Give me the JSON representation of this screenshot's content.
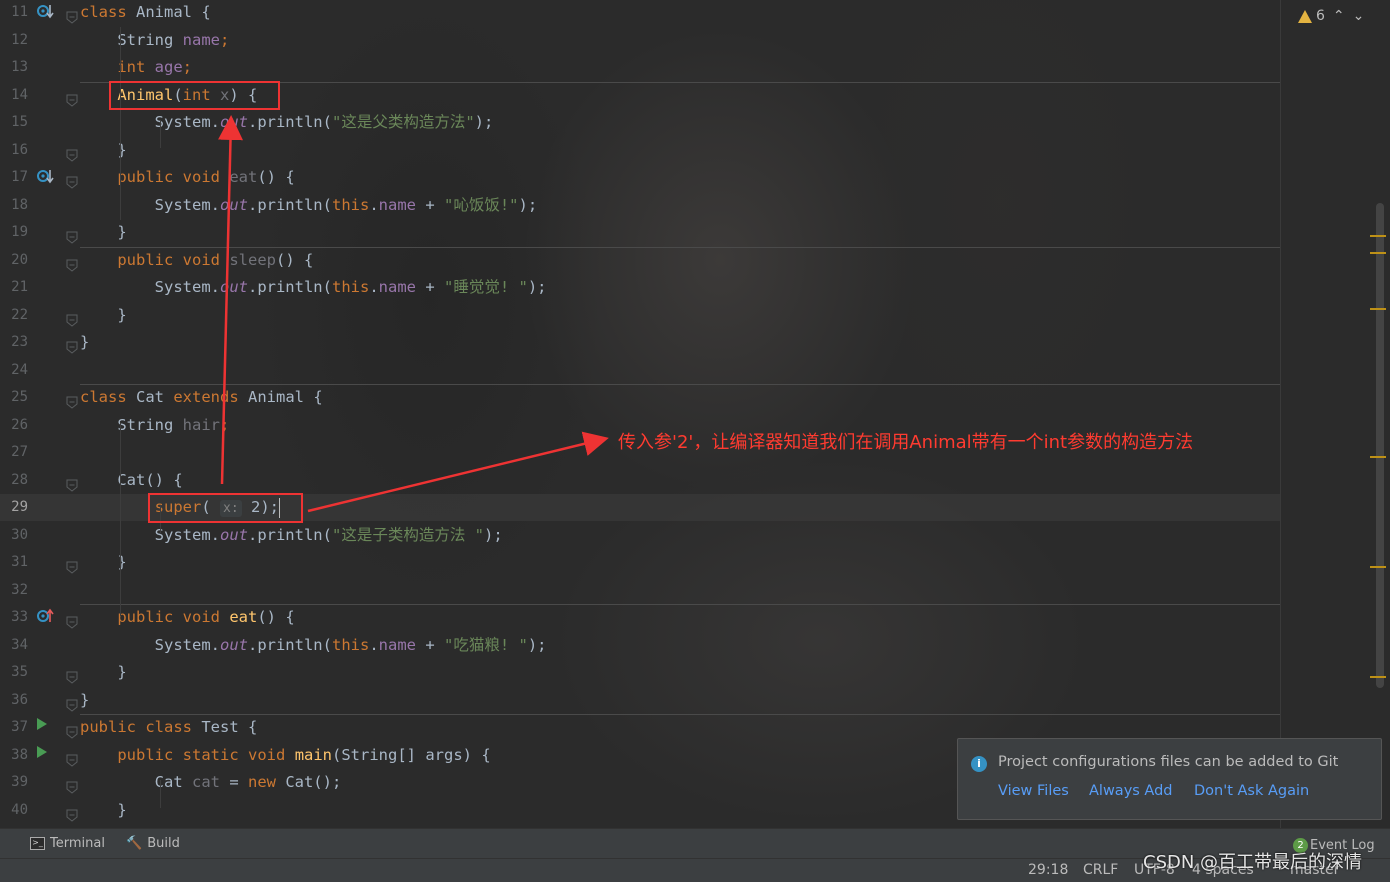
{
  "editor": {
    "lines": [
      {
        "n": "11",
        "tokens": [
          {
            "t": "class",
            "c": "kw"
          },
          {
            "t": " Animal {"
          }
        ]
      },
      {
        "n": "12",
        "tokens": [
          {
            "t": "    String "
          },
          {
            "t": "name",
            "c": "field"
          },
          {
            "t": ";",
            "c": "kw"
          }
        ]
      },
      {
        "n": "13",
        "tokens": [
          {
            "t": "    "
          },
          {
            "t": "int",
            "c": "kw"
          },
          {
            "t": " "
          },
          {
            "t": "age",
            "c": "field"
          },
          {
            "t": ";",
            "c": "kw"
          }
        ]
      },
      {
        "n": "14",
        "tokens": [
          {
            "t": "    "
          },
          {
            "t": "Animal",
            "c": "fn"
          },
          {
            "t": "("
          },
          {
            "t": "int",
            "c": "kw"
          },
          {
            "t": " "
          },
          {
            "t": "x",
            "c": "unused"
          },
          {
            "t": ") {"
          }
        ]
      },
      {
        "n": "15",
        "tokens": [
          {
            "t": "        System."
          },
          {
            "t": "out",
            "c": "ital"
          },
          {
            "t": ".println("
          },
          {
            "t": "\"这是父类构造方法\"",
            "c": "str"
          },
          {
            "t": ");"
          }
        ]
      },
      {
        "n": "16",
        "tokens": [
          {
            "t": "    }"
          }
        ]
      },
      {
        "n": "17",
        "tokens": [
          {
            "t": "    "
          },
          {
            "t": "public",
            "c": "kw"
          },
          {
            "t": " "
          },
          {
            "t": "void",
            "c": "kw"
          },
          {
            "t": " "
          },
          {
            "t": "eat",
            "c": "unused"
          },
          {
            "t": "() {"
          }
        ]
      },
      {
        "n": "18",
        "tokens": [
          {
            "t": "        System."
          },
          {
            "t": "out",
            "c": "ital"
          },
          {
            "t": ".println("
          },
          {
            "t": "this",
            "c": "kw"
          },
          {
            "t": "."
          },
          {
            "t": "name",
            "c": "field"
          },
          {
            "t": " + "
          },
          {
            "t": "\"吣饭饭!\"",
            "c": "str"
          },
          {
            "t": ");"
          }
        ]
      },
      {
        "n": "19",
        "tokens": [
          {
            "t": "    }"
          }
        ]
      },
      {
        "n": "20",
        "tokens": [
          {
            "t": "    "
          },
          {
            "t": "public",
            "c": "kw"
          },
          {
            "t": " "
          },
          {
            "t": "void",
            "c": "kw"
          },
          {
            "t": " "
          },
          {
            "t": "sleep",
            "c": "unused"
          },
          {
            "t": "() {"
          }
        ]
      },
      {
        "n": "21",
        "tokens": [
          {
            "t": "        System."
          },
          {
            "t": "out",
            "c": "ital"
          },
          {
            "t": ".println("
          },
          {
            "t": "this",
            "c": "kw"
          },
          {
            "t": "."
          },
          {
            "t": "name",
            "c": "field"
          },
          {
            "t": " + "
          },
          {
            "t": "\"睡觉觉! \"",
            "c": "str"
          },
          {
            "t": ");"
          }
        ]
      },
      {
        "n": "22",
        "tokens": [
          {
            "t": "    }"
          }
        ]
      },
      {
        "n": "23",
        "tokens": [
          {
            "t": "}"
          }
        ]
      },
      {
        "n": "24",
        "tokens": []
      },
      {
        "n": "25",
        "tokens": [
          {
            "t": "class",
            "c": "kw"
          },
          {
            "t": " Cat "
          },
          {
            "t": "extends",
            "c": "kw"
          },
          {
            "t": " Animal {"
          }
        ]
      },
      {
        "n": "26",
        "tokens": [
          {
            "t": "    String "
          },
          {
            "t": "hair",
            "c": "unused"
          },
          {
            "t": ";",
            "c": "kw"
          }
        ]
      },
      {
        "n": "27",
        "tokens": []
      },
      {
        "n": "28",
        "tokens": [
          {
            "t": "    Cat() {"
          }
        ]
      },
      {
        "n": "29",
        "tokens": [
          {
            "t": "        "
          },
          {
            "t": "super",
            "c": "kw"
          },
          {
            "t": "( "
          },
          {
            "t": "x:",
            "c": "hint"
          },
          {
            "t": " 2);"
          }
        ]
      },
      {
        "n": "30",
        "tokens": [
          {
            "t": "        System."
          },
          {
            "t": "out",
            "c": "ital"
          },
          {
            "t": ".println("
          },
          {
            "t": "\"这是子类构造方法 \"",
            "c": "str"
          },
          {
            "t": ");"
          }
        ]
      },
      {
        "n": "31",
        "tokens": [
          {
            "t": "    }"
          }
        ]
      },
      {
        "n": "32",
        "tokens": []
      },
      {
        "n": "33",
        "tokens": [
          {
            "t": "    "
          },
          {
            "t": "public",
            "c": "kw"
          },
          {
            "t": " "
          },
          {
            "t": "void",
            "c": "kw"
          },
          {
            "t": " "
          },
          {
            "t": "eat",
            "c": "fn"
          },
          {
            "t": "() {"
          }
        ]
      },
      {
        "n": "34",
        "tokens": [
          {
            "t": "        System."
          },
          {
            "t": "out",
            "c": "ital"
          },
          {
            "t": ".println("
          },
          {
            "t": "this",
            "c": "kw"
          },
          {
            "t": "."
          },
          {
            "t": "name",
            "c": "field"
          },
          {
            "t": " + "
          },
          {
            "t": "\"吃猫粮! \"",
            "c": "str"
          },
          {
            "t": ");"
          }
        ]
      },
      {
        "n": "35",
        "tokens": [
          {
            "t": "    }"
          }
        ]
      },
      {
        "n": "36",
        "tokens": [
          {
            "t": "}"
          }
        ]
      },
      {
        "n": "37",
        "tokens": [
          {
            "t": "public",
            "c": "kw"
          },
          {
            "t": " "
          },
          {
            "t": "class",
            "c": "kw"
          },
          {
            "t": " Test {"
          }
        ]
      },
      {
        "n": "38",
        "tokens": [
          {
            "t": "    "
          },
          {
            "t": "public",
            "c": "kw"
          },
          {
            "t": " "
          },
          {
            "t": "static",
            "c": "kw"
          },
          {
            "t": " "
          },
          {
            "t": "void",
            "c": "kw"
          },
          {
            "t": " "
          },
          {
            "t": "main",
            "c": "fn"
          },
          {
            "t": "(String[] args) {"
          }
        ]
      },
      {
        "n": "39",
        "tokens": [
          {
            "t": "        Cat "
          },
          {
            "t": "cat",
            "c": "unused"
          },
          {
            "t": " = "
          },
          {
            "t": "new",
            "c": "kw"
          },
          {
            "t": " Cat();"
          }
        ]
      },
      {
        "n": "40",
        "tokens": [
          {
            "t": "    }"
          }
        ]
      }
    ],
    "current_line": "29",
    "gutter_icons": {
      "11": "override-down-icon",
      "17": "override-down-icon",
      "33": "override-up-icon",
      "37": "run-icon",
      "38": "run-icon"
    }
  },
  "inspections": {
    "warning_count": "6"
  },
  "annotation": {
    "text": "传入参'2'，让编译器知道我们在调用Animal带有一个int参数的构造方法",
    "color": "#ff3b30"
  },
  "notification": {
    "message": "Project configurations files can be added to Git",
    "actions": [
      "View Files",
      "Always Add",
      "Don't Ask Again"
    ]
  },
  "toolbar": {
    "terminal": "Terminal",
    "build": "Build",
    "event_log": "Event Log",
    "event_count": "2"
  },
  "status": {
    "position": "29:18",
    "line_sep": "CRLF",
    "encoding": "UTF-8",
    "indent": "4 spaces",
    "branch": "master"
  },
  "watermark": "CSDN @百工带最后的深情",
  "colors": {
    "keyword": "#cc7832",
    "field": "#9876aa",
    "string": "#6a8759",
    "method": "#ffc66d",
    "link": "#589df6"
  }
}
